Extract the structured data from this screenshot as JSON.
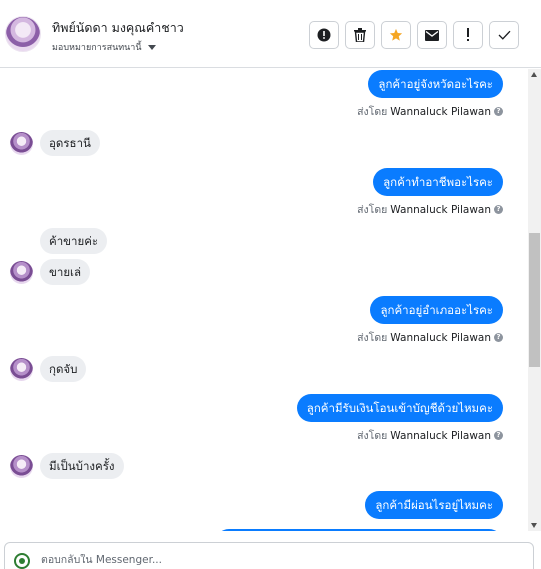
{
  "header": {
    "contact_name": "ทิพย์นัดดา มงคุณคำชาว",
    "assign_label": "มอบหมายการสนทนานี้",
    "actions": [
      {
        "icon": "alert-circle-icon"
      },
      {
        "icon": "trash-icon"
      },
      {
        "icon": "star-icon"
      },
      {
        "icon": "envelope-icon"
      },
      {
        "icon": "exclamation-icon"
      },
      {
        "icon": "check-icon"
      }
    ]
  },
  "thread": {
    "sent_by_prefix": "ส่งโดย",
    "sent_by_name": "Wannaluck Pilawan",
    "messages": [
      {
        "dir": "out",
        "text": "ลูกค้าอยู่จังหวัดอะไรคะ",
        "sent_by": true
      },
      {
        "dir": "in",
        "text": "อุดรธานี",
        "avatar": true
      },
      {
        "dir": "out",
        "text": "ลูกค้าทำอาชีพอะไรคะ",
        "sent_by": true
      },
      {
        "dir": "in",
        "text": "ค้าขายค่ะ",
        "avatar": false
      },
      {
        "dir": "in",
        "text": "ขายเล่",
        "avatar": true
      },
      {
        "dir": "out",
        "text": "ลูกค้าอยู่อำเภออะไรคะ",
        "sent_by": true
      },
      {
        "dir": "in",
        "text": "กุดจับ",
        "avatar": true
      },
      {
        "dir": "out",
        "text": "ลูกค้ามีรับเงินโอนเข้าบัญชีด้วยไหมคะ",
        "sent_by": true
      },
      {
        "dir": "in",
        "text": "มีเป็นบ้างครั้ง",
        "avatar": true
      },
      {
        "dir": "out",
        "text": "ลูกค้ามีผ่อนไรอยู่ไหมคะ",
        "sent_by": false
      }
    ]
  },
  "composer": {
    "placeholder": "ตอบกลับใน Messenger..."
  },
  "colors": {
    "outgoing_bubble": "#0a7cff",
    "incoming_bubble": "#eceef1",
    "star": "#f5a623"
  }
}
